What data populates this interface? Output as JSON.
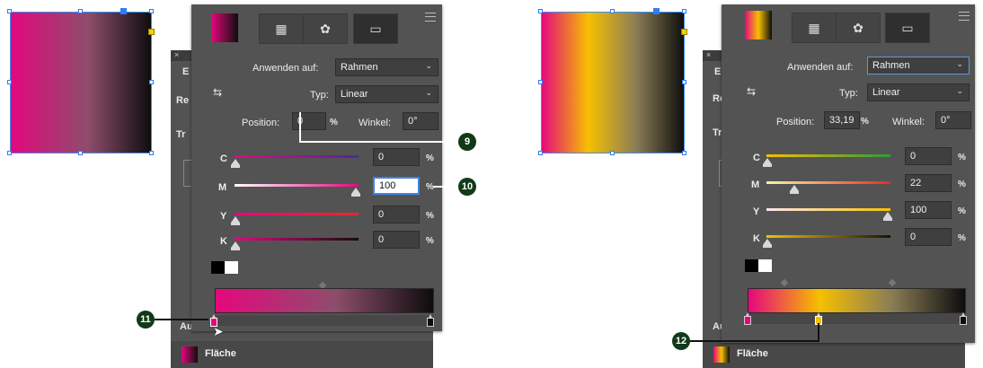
{
  "colors": {
    "magenta": "#e5077e",
    "yellow": "#f6c000",
    "black": "#0d0d0d",
    "panel_bg": "#535353",
    "callout_green": "#123a18"
  },
  "left": {
    "gradient_panel": {
      "tabs": [
        "swatches-icon",
        "color-icon",
        "gradient-icon"
      ],
      "apply_to_label": "Anwenden auf:",
      "apply_to_value": "Rahmen",
      "type_label": "Typ:",
      "type_value": "Linear",
      "position_label": "Position:",
      "position_value": "0",
      "position_unit": "%",
      "angle_label": "Winkel:",
      "angle_value": "0°",
      "sliders": [
        {
          "label": "C",
          "value": "0",
          "unit": "%",
          "thumb_pct": 0
        },
        {
          "label": "M",
          "value": "100",
          "unit": "%",
          "thumb_pct": 100
        },
        {
          "label": "Y",
          "value": "0",
          "unit": "%",
          "thumb_pct": 0
        },
        {
          "label": "K",
          "value": "0",
          "unit": "%",
          "thumb_pct": 0
        }
      ]
    },
    "background": {
      "e_label": "E",
      "re_label": "Re",
      "tr_label": "Tr",
      "au_label": "Au",
      "fill_label": "Fläche"
    },
    "callouts": [
      "9",
      "10",
      "11"
    ]
  },
  "right": {
    "gradient_panel": {
      "tabs": [
        "swatches-icon",
        "color-icon",
        "gradient-icon"
      ],
      "apply_to_label": "Anwenden auf:",
      "apply_to_value": "Rahmen",
      "type_label": "Typ:",
      "type_value": "Linear",
      "position_label": "Position:",
      "position_value": "33,19",
      "position_unit": "%",
      "angle_label": "Winkel:",
      "angle_value": "0°",
      "sliders": [
        {
          "label": "C",
          "value": "0",
          "unit": "%",
          "thumb_pct": 0
        },
        {
          "label": "M",
          "value": "22",
          "unit": "%",
          "thumb_pct": 22
        },
        {
          "label": "Y",
          "value": "100",
          "unit": "%",
          "thumb_pct": 100
        },
        {
          "label": "K",
          "value": "0",
          "unit": "%",
          "thumb_pct": 0
        }
      ]
    },
    "background": {
      "e_label": "E",
      "re_label": "Re",
      "tr_label": "Tr",
      "au_label": "Au",
      "fill_label": "Fläche"
    },
    "callouts": [
      "12"
    ]
  }
}
